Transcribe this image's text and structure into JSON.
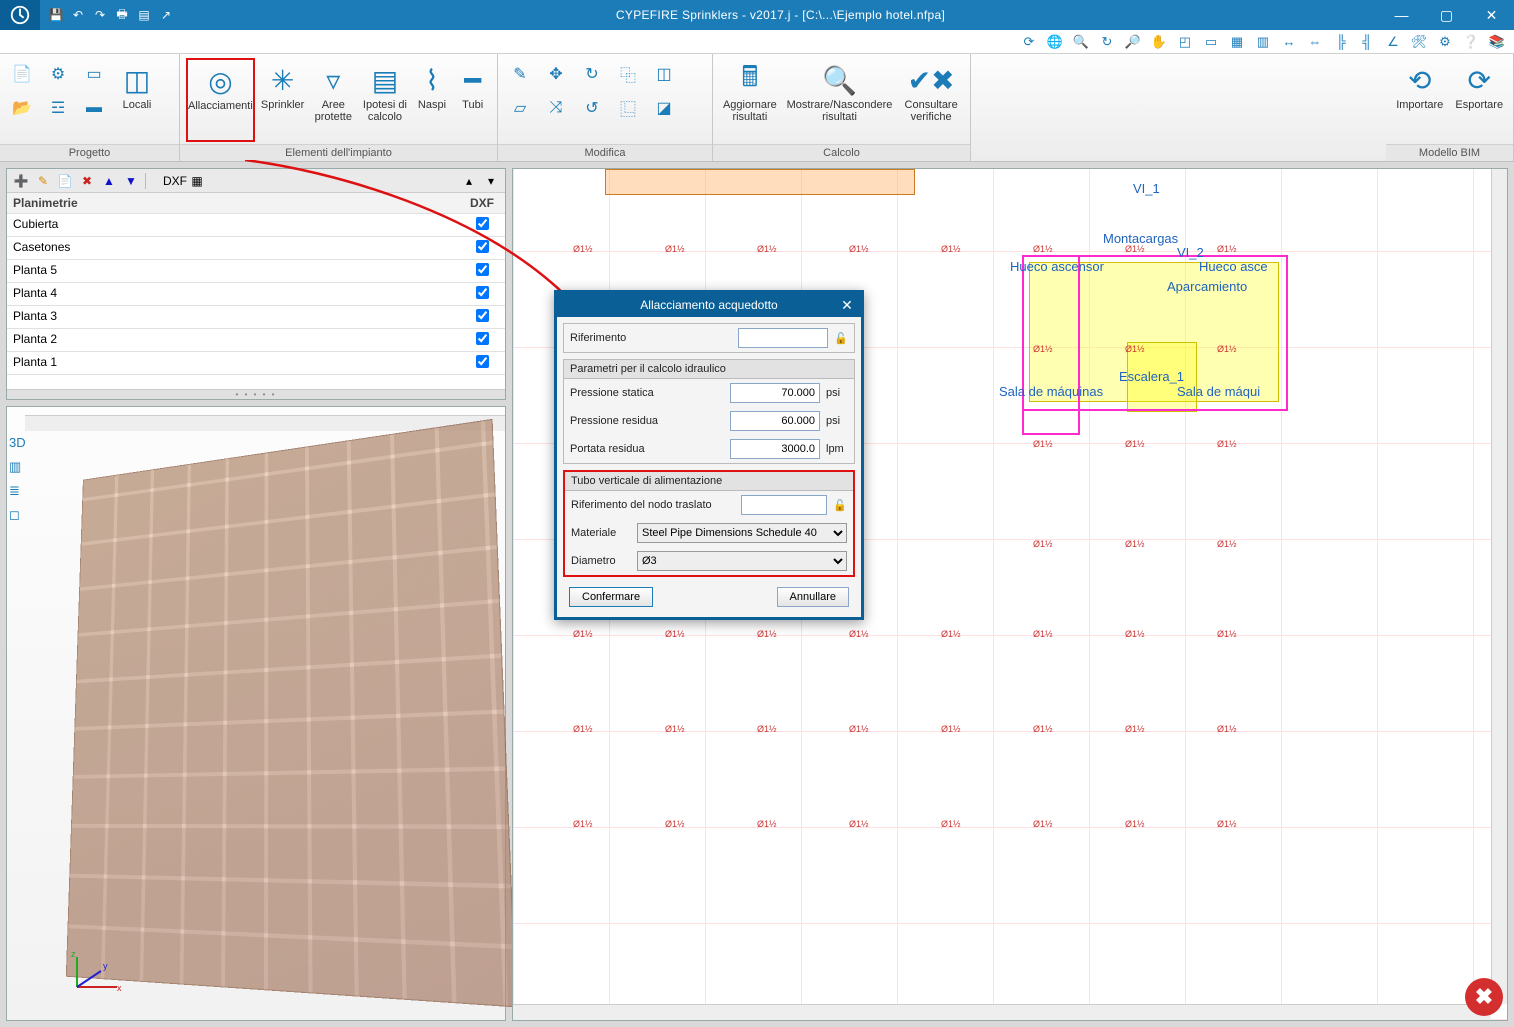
{
  "title": "CYPEFIRE Sprinklers - v2017.j - [C:\\...\\Ejemplo hotel.nfpa]",
  "ribbon": {
    "groups": {
      "progetto": "Progetto",
      "elementi": "Elementi dell'impianto",
      "modifica": "Modifica",
      "calcolo": "Calcolo",
      "bim": "Modello BIM"
    },
    "buttons": {
      "locali": "Locali",
      "allacciamenti": "Allacciamenti",
      "sprinkler": "Sprinkler",
      "aree": "Aree protette",
      "ipotesi": "Ipotesi di calcolo",
      "naspi": "Naspi",
      "tubi": "Tubi",
      "aggiornare": "Aggiornare risultati",
      "mostrare": "Mostrare/Nascondere risultati",
      "consultare": "Consultare verifiche",
      "importare": "Importare",
      "esportare": "Esportare"
    }
  },
  "planPanel": {
    "header_a": "Planimetrie",
    "header_b": "DXF",
    "rows": [
      {
        "name": "Cubierta",
        "checked": true
      },
      {
        "name": "Casetones",
        "checked": true
      },
      {
        "name": "Planta 5",
        "checked": true
      },
      {
        "name": "Planta 4",
        "checked": true
      },
      {
        "name": "Planta 3",
        "checked": true
      },
      {
        "name": "Planta 2",
        "checked": true
      },
      {
        "name": "Planta 1",
        "checked": true
      }
    ]
  },
  "drawing": {
    "labels": {
      "vi1": "VI_1",
      "vi2": "VI_2",
      "montacargas": "Montacargas",
      "hueco_asc_l": "Hueco ascensor",
      "hueco_asc_r": "Hueco asce",
      "aparcamiento": "Aparcamiento",
      "escalera": "Escalera_1",
      "sala_maquinas_l": "Sala de máquinas",
      "sala_maquinas_r": "Sala de máqui"
    },
    "pipe_annot": "Ø1½"
  },
  "dialog": {
    "title": "Allacciamento acquedotto",
    "ref_label": "Riferimento",
    "ref_value": "",
    "sec_h1": "Parametri per il calcolo idraulico",
    "press_stat_l": "Pressione statica",
    "press_stat_v": "70.000",
    "press_res_l": "Pressione residua",
    "press_res_v": "60.000",
    "portata_l": "Portata residua",
    "portata_v": "3000.0",
    "unit_psi": "psi",
    "unit_lpm": "lpm",
    "sec_h2": "Tubo verticale di alimentazione",
    "nodo_l": "Riferimento del nodo traslato",
    "nodo_v": "",
    "materiale_l": "Materiale",
    "materiale_v": "Steel Pipe Dimensions Schedule 40",
    "diametro_l": "Diametro",
    "diametro_v": "Ø3",
    "confermare": "Confermare",
    "annullare": "Annullare"
  }
}
